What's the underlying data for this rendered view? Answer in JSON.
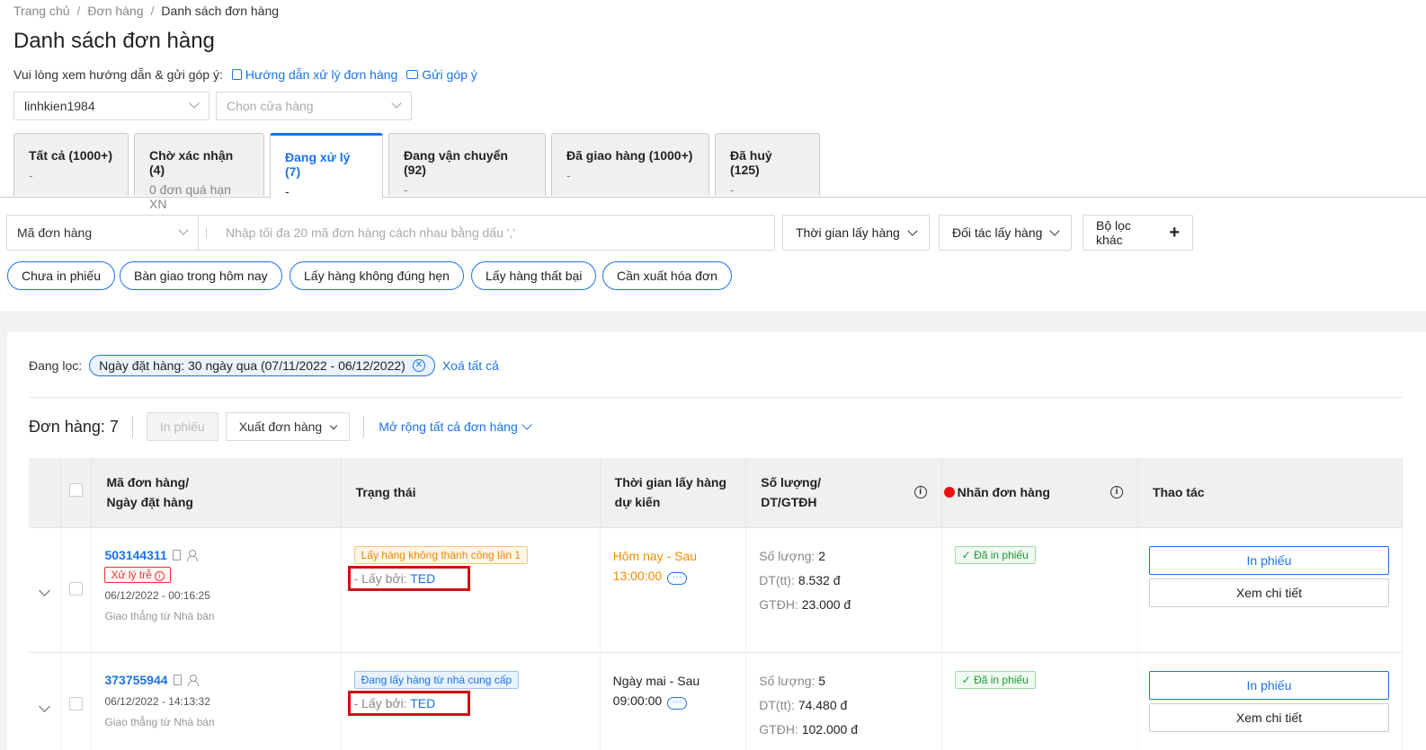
{
  "breadcrumb": [
    "Trang chủ",
    "Đơn hàng",
    "Danh sách đơn hàng"
  ],
  "page_title": "Danh sách đơn hàng",
  "guide": {
    "prompt": "Vui lòng xem hướng dẫn & gửi góp ý:",
    "link_guide": "Hướng dẫn xử lý đơn hàng",
    "link_feedback": "Gửi góp ý"
  },
  "selects": {
    "account": "linhkien1984",
    "store_placeholder": "Chọn cửa hàng"
  },
  "tabs": [
    {
      "label": "Tất cả (1000+)",
      "sub": "-"
    },
    {
      "label": "Chờ xác nhận (4)",
      "sub": "0 đơn quá hạn XN"
    },
    {
      "label": "Đang xử lý (7)",
      "sub": "-"
    },
    {
      "label": "Đang vận chuyển (92)",
      "sub": "-"
    },
    {
      "label": "Đã giao hàng (1000+)",
      "sub": "-"
    },
    {
      "label": "Đã huỷ (125)",
      "sub": "-"
    }
  ],
  "search": {
    "type": "Mã đơn hàng",
    "placeholder": "Nhập tối đa 20 mã đơn hàng cách nhau bằng dấu ','",
    "pickup_time": "Thời gian lấy hàng",
    "pickup_partner": "Đối tác lấy hàng",
    "other_filters": "Bộ lọc khác"
  },
  "quick_filters": [
    "Chưa in phiếu",
    "Bàn giao trong hôm nay",
    "Lấy hàng không đúng hẹn",
    "Lấy hàng thất bại",
    "Cần xuất hóa đơn"
  ],
  "active_filter": {
    "label": "Đang lọc:",
    "chip": "Ngày đặt hàng: 30 ngày qua (07/11/2022 - 06/12/2022)",
    "clear_all": "Xoá tất cả"
  },
  "orders_bar": {
    "count": "Đơn hàng: 7",
    "print": "In phiếu",
    "export": "Xuất đơn hàng",
    "expand_all": "Mở rộng tất cả đơn hàng"
  },
  "table": {
    "headers": {
      "order_line1": "Mã đơn hàng/",
      "order_line2": "Ngày đặt hàng",
      "status": "Trạng thái",
      "pickup_line1": "Thời gian lấy hàng",
      "pickup_line2": "dự kiến",
      "qty_line1": "Số lượng/",
      "qty_line2": "DT/GTĐH",
      "label": "Nhãn đơn hàng",
      "actions": "Thao tác"
    },
    "rows": [
      {
        "id": "503144311",
        "late": "Xử lý trễ",
        "date": "06/12/2022 - 00:16:25",
        "ship": "Giao thẳng từ Nhà bán",
        "status_tag": "Lấy hàng không thành công lần 1",
        "picked_by_label": "- Lấy bởi:",
        "carrier": "TED",
        "time_line1": "Hôm nay - Sau",
        "time_line2": "13:00:00",
        "qty_label": "Số lượng:",
        "qty": "2",
        "dt_label": "DT(tt):",
        "dt": "8.532 đ",
        "gtdh_label": "GTĐH:",
        "gtdh": "23.000 đ",
        "label_tag": "Đã in phiếu",
        "btn_print": "In phiếu",
        "btn_detail": "Xem chi tiết"
      },
      {
        "id": "373755944",
        "date": "06/12/2022 - 14:13:32",
        "ship": "Giao thẳng từ Nhà bán",
        "status_tag": "Đang lấy hàng từ nhà cung cấp",
        "picked_by_label": "- Lấy bởi:",
        "carrier": "TED",
        "time_line1": "Ngày mai - Sau",
        "time_line2": "09:00:00",
        "qty_label": "Số lượng:",
        "qty": "5",
        "dt_label": "DT(tt):",
        "dt": "74.480 đ",
        "gtdh_label": "GTĐH:",
        "gtdh": "102.000 đ",
        "label_tag": "Đã in phiếu",
        "btn_print": "In phiếu",
        "btn_detail": "Xem chi tiết"
      }
    ]
  },
  "colors": {
    "accent": "#1a73e8",
    "highlight_box": "#d01010",
    "late": "#e33333",
    "orange": "#f08c00",
    "green": "#1a9a3a"
  }
}
